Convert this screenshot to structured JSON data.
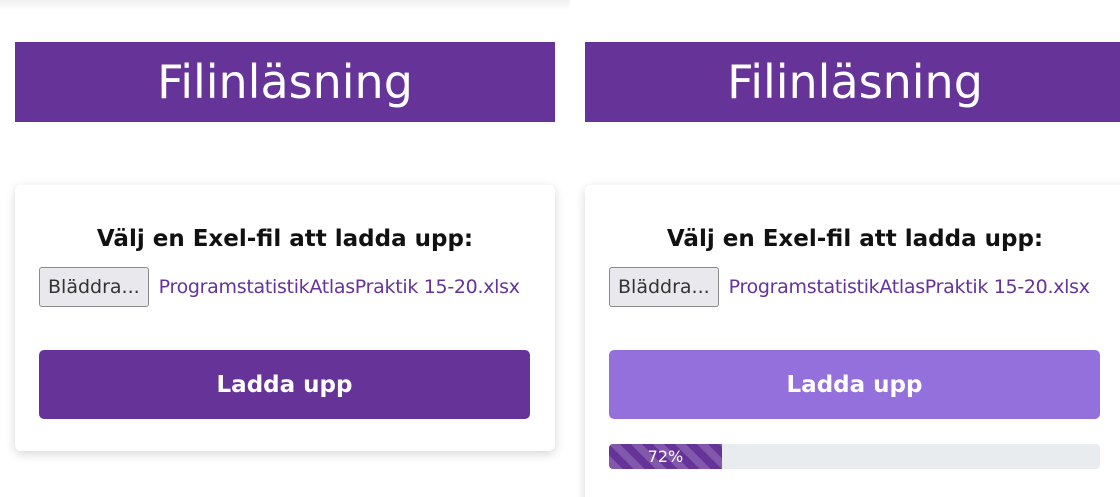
{
  "panels": [
    {
      "title": "Filinläsning",
      "prompt": "Välj en Exel-fil att ladda upp:",
      "browse_label": "Bläddra...",
      "file_name": "ProgramstatistikAtlasPraktik 15-20.xlsx",
      "upload_label": "Ladda upp",
      "upload_state": "enabled"
    },
    {
      "title": "Filinläsning",
      "prompt": "Välj en Exel-fil att ladda upp:",
      "browse_label": "Bläddra...",
      "file_name": "ProgramstatistikAtlasPraktik 15-20.xlsx",
      "upload_label": "Ladda upp",
      "upload_state": "disabled",
      "progress": {
        "value": 72,
        "label": "72%"
      }
    }
  ],
  "colors": {
    "primary": "#663399",
    "primary_light": "#9370db",
    "progress_track": "#e9ecef"
  }
}
